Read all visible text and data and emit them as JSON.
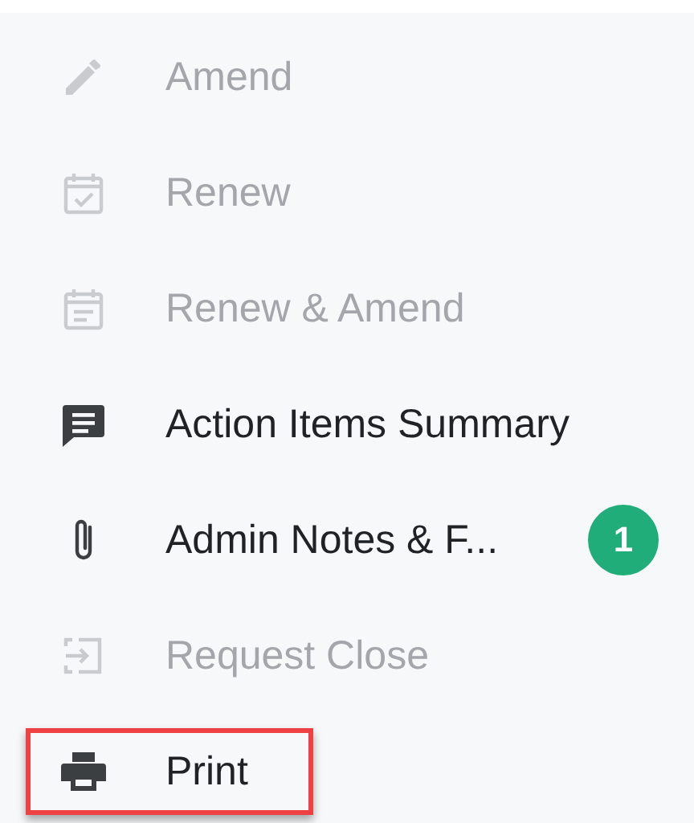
{
  "menu": {
    "items": [
      {
        "label": "Amend",
        "disabled": true,
        "highlighted": false
      },
      {
        "label": "Renew",
        "disabled": true,
        "highlighted": false
      },
      {
        "label": "Renew & Amend",
        "disabled": true,
        "highlighted": false
      },
      {
        "label": "Action Items Summary",
        "disabled": false,
        "highlighted": false
      },
      {
        "label": "Admin Notes & F...",
        "disabled": false,
        "highlighted": false,
        "badge": "1"
      },
      {
        "label": "Request Close",
        "disabled": true,
        "highlighted": false
      },
      {
        "label": "Print",
        "disabled": false,
        "highlighted": true
      }
    ]
  }
}
